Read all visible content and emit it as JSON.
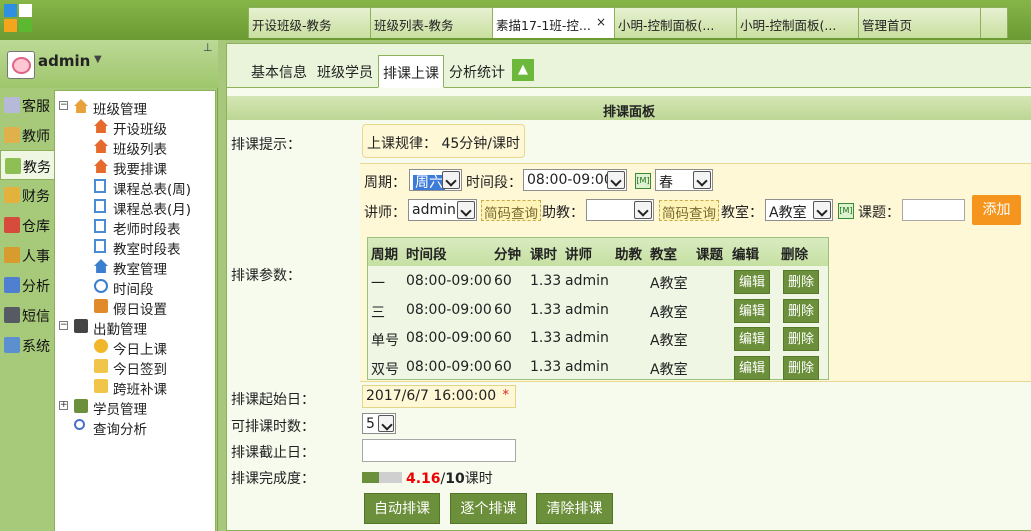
{
  "window_tabs": [
    {
      "label": "开设班级-教务",
      "active": false
    },
    {
      "label": "班级列表-教务",
      "active": false
    },
    {
      "label": "素描17-1班-控...",
      "active": true,
      "close": "×"
    },
    {
      "label": "小明-控制面板(...",
      "active": false
    },
    {
      "label": "小明-控制面板(...",
      "active": false
    },
    {
      "label": "管理首页",
      "active": false
    }
  ],
  "user": {
    "name": "admin",
    "caret": "▼",
    "pin": "📌"
  },
  "nav_categories": [
    {
      "label": "客服",
      "color": "#b7b9d8"
    },
    {
      "label": "教师",
      "color": "#e0b04a"
    },
    {
      "label": "教务",
      "color": "#8dbf55",
      "active": true
    },
    {
      "label": "财务",
      "color": "#e2b23c"
    },
    {
      "label": "仓库",
      "color": "#d64b3c"
    },
    {
      "label": "人事",
      "color": "#d89b2e"
    },
    {
      "label": "分析",
      "color": "#4f7fd0"
    },
    {
      "label": "短信",
      "color": "#555a63"
    },
    {
      "label": "系统",
      "color": "#5b8fd0"
    }
  ],
  "tree": [
    {
      "label": "班级管理",
      "level": 0,
      "expander": "−",
      "icon": "house-icon",
      "color": "#e8a23c"
    },
    {
      "label": "开设班级",
      "level": 1,
      "icon": "house-icon",
      "color": "#e56a2c"
    },
    {
      "label": "班级列表",
      "level": 1,
      "icon": "house-icon",
      "color": "#e56a2c"
    },
    {
      "label": "我要排课",
      "level": 1,
      "icon": "house-icon",
      "color": "#e56a2c"
    },
    {
      "label": "课程总表(周)",
      "level": 1,
      "icon": "document-icon",
      "color": "#4a8bd6"
    },
    {
      "label": "课程总表(月)",
      "level": 1,
      "icon": "document-icon",
      "color": "#4a8bd6"
    },
    {
      "label": "老师时段表",
      "level": 1,
      "icon": "document-icon",
      "color": "#4a8bd6"
    },
    {
      "label": "教室时段表",
      "level": 1,
      "icon": "document-icon",
      "color": "#4a8bd6"
    },
    {
      "label": "教室管理",
      "level": 1,
      "icon": "house-icon",
      "color": "#3b7ed0"
    },
    {
      "label": "时间段",
      "level": 1,
      "icon": "clock-icon",
      "color": "#3b7ed0"
    },
    {
      "label": "假日设置",
      "level": 1,
      "icon": "holiday-icon",
      "color": "#e08a2a"
    },
    {
      "label": "出勤管理",
      "level": 0,
      "expander": "−",
      "icon": "person-icon",
      "color": "#444"
    },
    {
      "label": "今日上课",
      "level": 1,
      "icon": "sun-icon",
      "color": "#f1b72b"
    },
    {
      "label": "今日签到",
      "level": 1,
      "icon": "card-icon",
      "color": "#f1c44a"
    },
    {
      "label": "跨班补课",
      "level": 1,
      "icon": "card-icon",
      "color": "#f1c44a"
    },
    {
      "label": "学员管理",
      "level": 0,
      "expander": "+",
      "icon": "group-icon",
      "color": "#6b8f3a"
    },
    {
      "label": "查询分析",
      "level": 0,
      "icon": "search-icon",
      "color": "#4a6fd0"
    }
  ],
  "sub_tabs": [
    "基本信息",
    "班级学员",
    "排课上课",
    "分析统计"
  ],
  "sub_tab_up": "▲",
  "panel_title": "排课面板",
  "labels": {
    "hint": "排课提示：",
    "params": "排课参数：",
    "start": "排课起始日：",
    "count": "可排课时数：",
    "end": "排课截止日：",
    "progress": "排课完成度："
  },
  "hint_text": "上课规律： 45分钟/课时",
  "params": {
    "week_label": "周期：",
    "week_value": "周六",
    "period_label": "时间段：",
    "period_value": "08:00-09:00",
    "season_value": "春",
    "m_icon_text": "[M]",
    "teacher_label": "讲师：",
    "teacher_value": "admin",
    "code_query": "简码查询",
    "assistant_label": "助教：",
    "assistant_value": "",
    "room_label": "教室：",
    "room_value": "A教室",
    "topic_label": "课题：",
    "topic_value": "",
    "add": "添加"
  },
  "schedule_table": {
    "headers": [
      "周期",
      "时间段",
      "分钟",
      "课时",
      "讲师",
      "助教",
      "教室",
      "课题",
      "编辑",
      "删除"
    ],
    "rows": [
      {
        "week": "一",
        "period": "08:00-09:00",
        "minutes": "60",
        "hours": "1.33",
        "teacher": "admin",
        "assistant": "",
        "room": "A教室",
        "topic": "",
        "edit": "编辑",
        "delete": "删除"
      },
      {
        "week": "三",
        "period": "08:00-09:00",
        "minutes": "60",
        "hours": "1.33",
        "teacher": "admin",
        "assistant": "",
        "room": "A教室",
        "topic": "",
        "edit": "编辑",
        "delete": "删除"
      },
      {
        "week": "单号",
        "period": "08:00-09:00",
        "minutes": "60",
        "hours": "1.33",
        "teacher": "admin",
        "assistant": "",
        "room": "A教室",
        "topic": "",
        "edit": "编辑",
        "delete": "删除"
      },
      {
        "week": "双号",
        "period": "08:00-09:00",
        "minutes": "60",
        "hours": "1.33",
        "teacher": "admin",
        "assistant": "",
        "room": "A教室",
        "topic": "",
        "edit": "编辑",
        "delete": "删除"
      }
    ]
  },
  "start_date": "2017/6/7 16:00:00",
  "required_mark": "*",
  "count_value": "5",
  "end_date": "",
  "progress": {
    "done": "4.16",
    "slash": "/",
    "total": "10",
    "unit": "课时",
    "fraction": 0.416
  },
  "buttons": {
    "auto": "自动排课",
    "each": "逐个排课",
    "clear": "清除排课"
  },
  "colors": {
    "accent_green": "#6b8f3a",
    "add_orange": "#f6951d",
    "required_red": "#e02020"
  }
}
